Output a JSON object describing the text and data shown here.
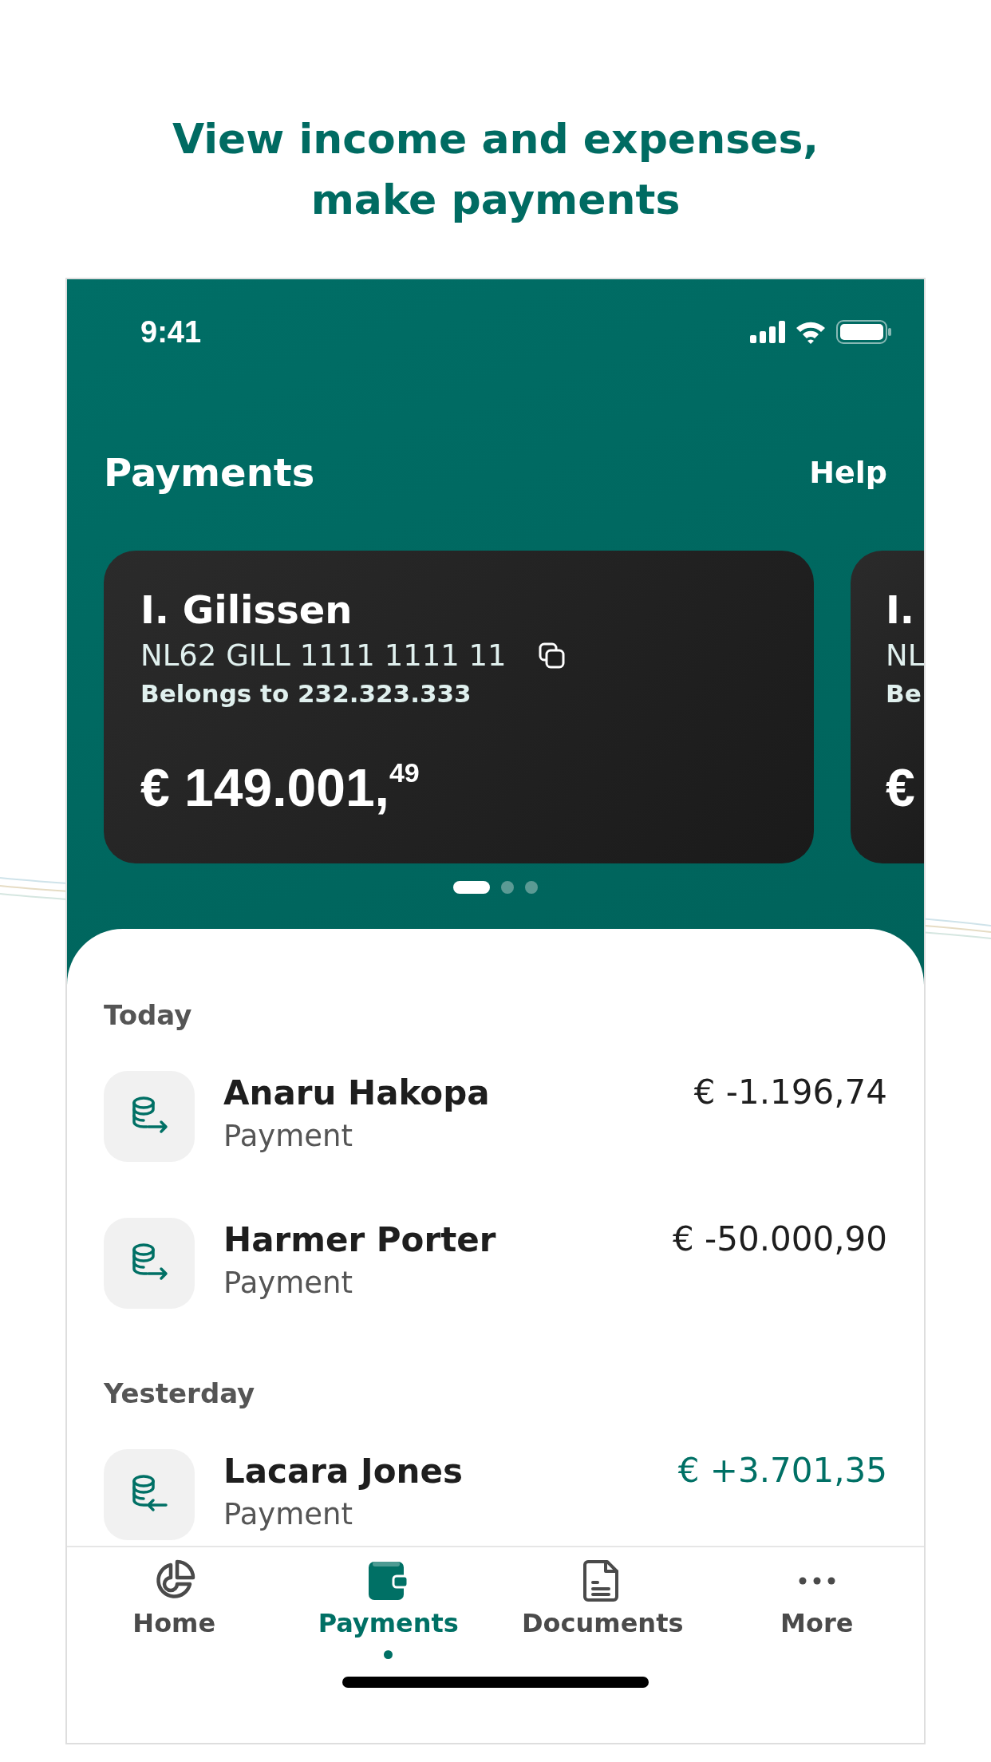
{
  "headline": [
    "View income and expenses,",
    "make payments"
  ],
  "status_bar": {
    "time": "9:41"
  },
  "header": {
    "title": "Payments",
    "help": "Help"
  },
  "cards": [
    {
      "kind": "full",
      "name": "I. Gilissen",
      "iban": "NL62 GILL 1111 1111 11",
      "owner": "Belongs to 232.323.333",
      "amount": "€ 149.001,",
      "cents": "49"
    },
    {
      "kind": "partial",
      "name": "I.",
      "iban": "NL",
      "owner": "Be",
      "amount": "€"
    }
  ],
  "pager": [
    {
      "selected": true
    },
    {
      "selected": false
    },
    {
      "selected": false
    }
  ],
  "sections": [
    {
      "title": "Today",
      "items": [
        {
          "kind": "outgoing",
          "name": "Anaru Hakopa",
          "type": "Payment",
          "amount": "€ -1.196,74"
        },
        {
          "kind": "outgoing",
          "name": "Harmer Porter",
          "type": "Payment",
          "amount": "€ -50.000,90"
        }
      ]
    },
    {
      "title": "Yesterday",
      "items": [
        {
          "kind": "incoming",
          "name": "Lacara Jones",
          "type": "Payment",
          "amount": "€ +3.701,35"
        }
      ]
    }
  ],
  "nav": [
    {
      "kind": "home",
      "label": "Home",
      "selected": false
    },
    {
      "kind": "payments",
      "label": "Payments",
      "selected": true
    },
    {
      "kind": "documents",
      "label": "Documents",
      "selected": false
    },
    {
      "kind": "more",
      "label": "More",
      "selected": false
    }
  ]
}
